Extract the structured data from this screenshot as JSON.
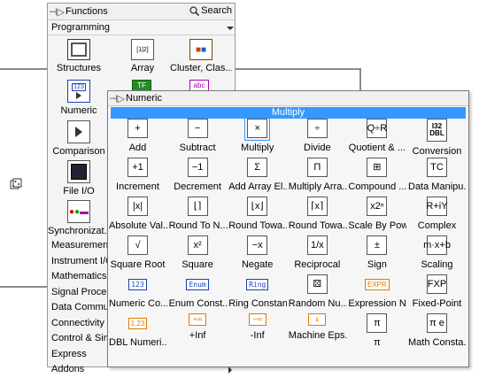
{
  "functions_palette": {
    "title": "Functions",
    "search_label": "Search",
    "category": "Programming",
    "left_items": [
      {
        "label": "Structures",
        "icon": "structures-icon"
      },
      {
        "label": "Numeric",
        "icon": "numeric-icon"
      },
      {
        "label": "Comparison",
        "icon": "comparison-icon"
      },
      {
        "label": "File I/O",
        "icon": "file-io-icon"
      },
      {
        "label": "Synchronizat...",
        "icon": "synchronization-icon"
      }
    ],
    "right_items": [
      {
        "label": "Array",
        "icon": "array-icon"
      },
      {
        "label": "Cluster, Clas...",
        "icon": "cluster-icon"
      }
    ],
    "categories": [
      "Measurement I/O",
      "Instrument I/O",
      "Mathematics",
      "Signal Processing",
      "Data Communication",
      "Connectivity",
      "Control & Simulation",
      "Express",
      "Addons"
    ]
  },
  "numeric_palette": {
    "title": "Numeric",
    "highlighted": "Multiply",
    "items": [
      [
        "Add",
        "Subtract",
        "Multiply",
        "Divide",
        "Quotient & ...",
        "Conversion"
      ],
      [
        "Increment",
        "Decrement",
        "Add Array El...",
        "Multiply Arra...",
        "Compound ...",
        "Data Manipu..."
      ],
      [
        "Absolute Val...",
        "Round To N...",
        "Round Towa...",
        "Round Towa...",
        "Scale By Pow...",
        "Complex"
      ],
      [
        "Square Root",
        "Square",
        "Negate",
        "Reciprocal",
        "Sign",
        "Scaling"
      ],
      [
        "Numeric Co...",
        "Enum Const...",
        "Ring Constant",
        "Random Nu...",
        "Expression N...",
        "Fixed-Point"
      ],
      [
        "DBL Numeri...",
        "+Inf",
        "-Inf",
        "Machine Eps...",
        "π",
        "Math Consta..."
      ]
    ]
  }
}
